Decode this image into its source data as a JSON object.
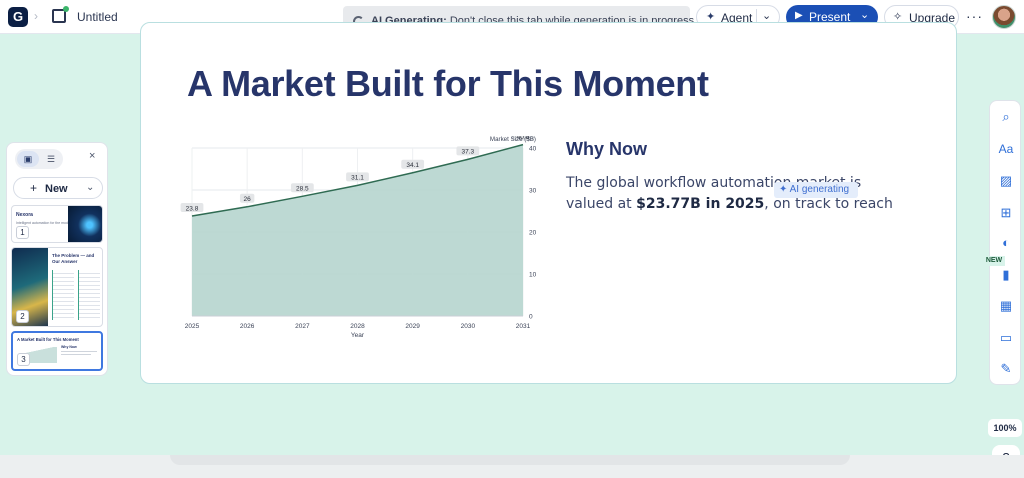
{
  "topbar": {
    "logo_letter": "G",
    "crumb_sep": "›",
    "doc_title": "Untitled",
    "toast_bold": "AI Generating:",
    "toast_text": " Don't close this tab while generation is in progress.",
    "agent_label": "Agent",
    "present_label": "Present",
    "upgrade_label": "Upgrade",
    "more": "···"
  },
  "slide": {
    "title": "A Market Built for This Moment",
    "why_heading": "Why Now",
    "why_body_1": "The global workflow automation market is valued at ",
    "why_body_bold": "$23.77B in 2025",
    "why_body_2": ", on track to reach",
    "ai_chip": "✦ AI generating"
  },
  "chart_data": {
    "type": "area",
    "x": [
      2025,
      2026,
      2027,
      2028,
      2029,
      2030,
      2031
    ],
    "values": [
      23.8,
      26,
      28.5,
      31.1,
      34.1,
      37.3,
      40.8
    ],
    "data_labels": [
      "23.8",
      "26",
      "28.5",
      "31.1",
      "34.1",
      "37.3",
      "40.8"
    ],
    "xlabel": "Year",
    "ylabel": "Market Size ($B)",
    "ylim": [
      0,
      40
    ],
    "yticks": [
      0,
      10,
      20,
      30,
      40
    ],
    "y_axis_side": "right",
    "grid": true,
    "colors": {
      "fill": "#b9d7d1",
      "line": "#2f6b52",
      "label_bg": "#e4e6e8"
    }
  },
  "thumbs": {
    "new_label": "New",
    "close": "×",
    "items": [
      {
        "num": "1",
        "title": "Nexora",
        "sub": "Intelligent automation for the modern enterprise"
      },
      {
        "num": "2",
        "title": "The Problem — and Our Answer"
      },
      {
        "num": "3",
        "title": "A Market Built for This Moment",
        "sub": "Why Now"
      }
    ]
  },
  "tools": {
    "new_tag": "NEW",
    "zoom": "100%",
    "help": "?"
  },
  "colors": {
    "accent": "#1b4fb5",
    "canvas_bg": "#d8f3ea",
    "title": "#27356a"
  }
}
